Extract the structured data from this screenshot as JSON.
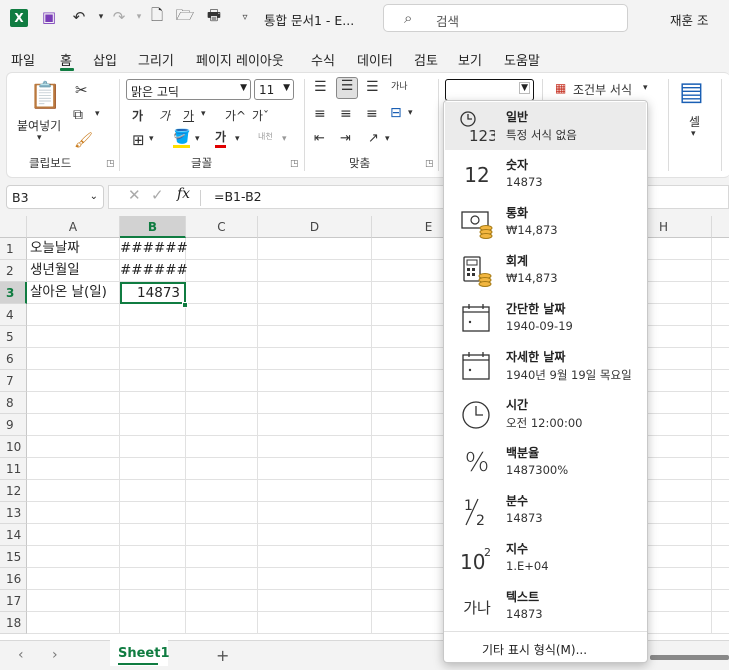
{
  "titlebar": {
    "title": "통합 문서1 - E...",
    "search_placeholder": "검색",
    "user": "재훈 조"
  },
  "menu": [
    "파일",
    "홈",
    "삽입",
    "그리기",
    "페이지 레이아웃",
    "수식",
    "데이터",
    "검토",
    "보기",
    "도움말"
  ],
  "ribbon": {
    "clipboard": {
      "paste_label": "붙여넣기",
      "group_label": "클립보드"
    },
    "font": {
      "font_name": "맑은 고딕",
      "font_size": "11",
      "group_label": "글꼴",
      "bold": "가",
      "italic": "가",
      "underline": "가",
      "grow": "가^",
      "shrink": "가ˇ",
      "font_color": "가",
      "phonetic": "내천"
    },
    "alignment": {
      "group_label": "맞춤",
      "wrap": "가나"
    },
    "number": {
      "format_value": ""
    },
    "styles": {
      "conditional_label": "조건부 서식"
    },
    "cells": {
      "label": "셀"
    }
  },
  "formula_bar": {
    "name_box": "B3",
    "fx": "fx",
    "formula": "=B1-B2"
  },
  "grid": {
    "columns": [
      "A",
      "B",
      "C",
      "D",
      "E",
      "H"
    ],
    "rows": [
      "1",
      "2",
      "3",
      "4",
      "5",
      "6",
      "7",
      "8",
      "9",
      "10",
      "11",
      "12",
      "13",
      "14",
      "15",
      "16",
      "17",
      "18"
    ],
    "cells": {
      "A1": "오늘날짜",
      "B1": "######",
      "A2": "생년월일",
      "B2": "######",
      "A3": "살아온 날(일)",
      "B3": "14873"
    }
  },
  "sheets": {
    "active": "Sheet1",
    "add": "+"
  },
  "number_format_menu": {
    "items": [
      {
        "icon": "123",
        "name": "일반",
        "example": "특정 서식 없음"
      },
      {
        "icon": "12",
        "name": "숫자",
        "example": "14873"
      },
      {
        "icon": "currency-icon",
        "name": "통화",
        "example": "₩14,873"
      },
      {
        "icon": "accounting-icon",
        "name": "회계",
        "example": " ₩14,873"
      },
      {
        "icon": "calendar-icon",
        "name": "간단한 날짜",
        "example": "1940-09-19"
      },
      {
        "icon": "calendar-icon",
        "name": "자세한 날짜",
        "example": "1940년 9월 19일 목요일"
      },
      {
        "icon": "clock-icon",
        "name": "시간",
        "example": "오전 12:00:00"
      },
      {
        "icon": "%",
        "name": "백분율",
        "example": "1487300%"
      },
      {
        "icon": "½",
        "name": "분수",
        "example": "14873"
      },
      {
        "icon": "10²",
        "name": "지수",
        "example": "1.E+04"
      },
      {
        "icon": "가나",
        "name": "텍스트",
        "example": "14873"
      }
    ],
    "more": "기타 표시 형식(M)..."
  },
  "colors": {
    "accent": "#107c41"
  }
}
